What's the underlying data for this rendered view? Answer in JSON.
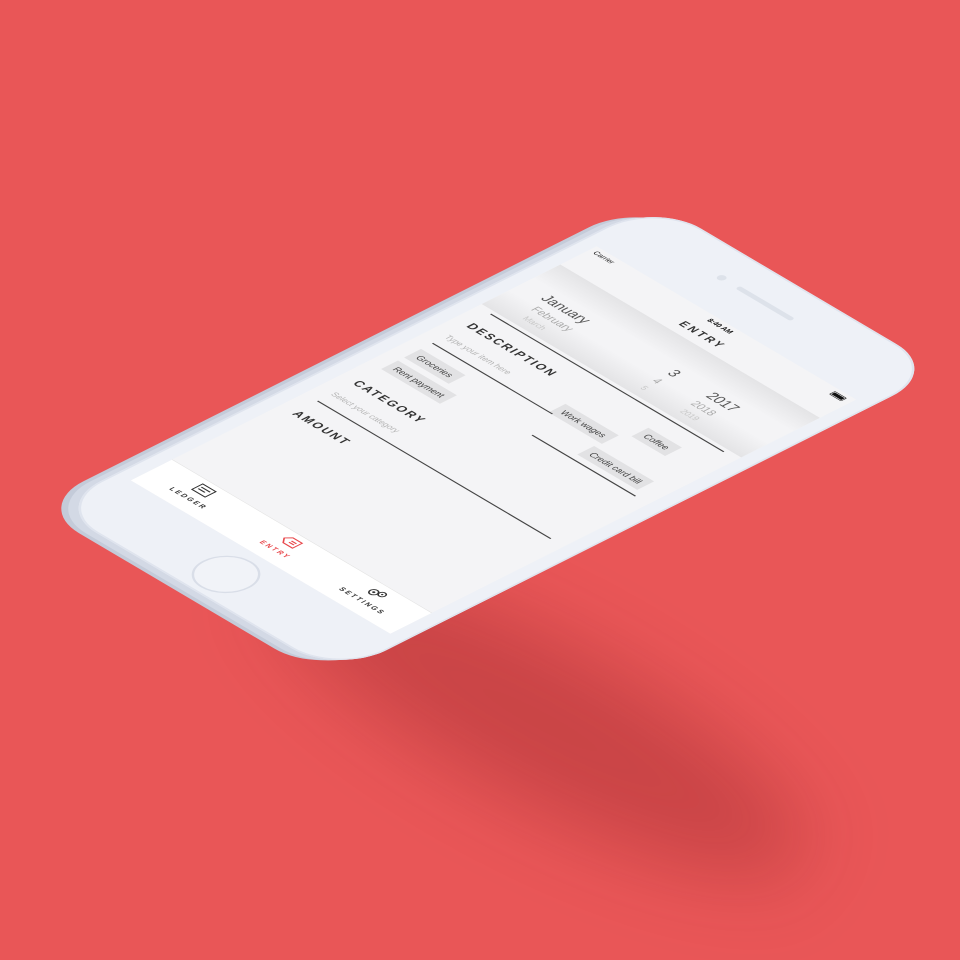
{
  "status_bar": {
    "carrier": "Carrier",
    "time": "8:40 AM"
  },
  "header": {
    "title": "ENTRY"
  },
  "date_picker": {
    "months": [
      "January",
      "February",
      "March"
    ],
    "days": [
      "3",
      "4",
      "5"
    ],
    "years": [
      "2017",
      "2018",
      "2019"
    ]
  },
  "description": {
    "label": "DESCRIPTION",
    "placeholder": "Type your item here",
    "suggestions": [
      "Coffee",
      "Work wages",
      "Credit card bill",
      "Groceries",
      "Rent payment"
    ]
  },
  "category": {
    "label": "CATEGORY",
    "placeholder": "Select your category"
  },
  "amount": {
    "label": "AMOUNT"
  },
  "tabbar": {
    "tabs": [
      {
        "label": "LEDGER",
        "icon": "ledger-icon"
      },
      {
        "label": "ENTRY",
        "icon": "entry-icon"
      },
      {
        "label": "SETTINGS",
        "icon": "settings-icon"
      }
    ],
    "active": "ENTRY"
  },
  "colors": {
    "background": "#E95657",
    "accent": "#E8474B",
    "phone_body": "#EEF1F7"
  }
}
